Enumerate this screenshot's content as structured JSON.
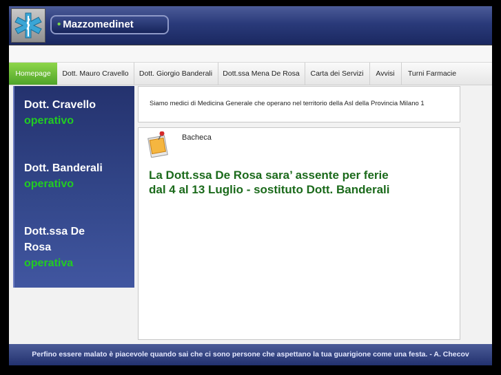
{
  "header": {
    "brand": "Mazzomedinet",
    "brand_dot": "•"
  },
  "nav": {
    "items": [
      {
        "label": "Homepage"
      },
      {
        "label": "Dott. Mauro Cravello"
      },
      {
        "label": "Dott. Giorgio Banderali"
      },
      {
        "label": "Dott.ssa Mena De Rosa"
      },
      {
        "label": "Carta dei Servizi"
      },
      {
        "label": "Avvisi"
      },
      {
        "label": "Turni Farmacie"
      }
    ],
    "active": "Homepage"
  },
  "sidebar": {
    "doctors": [
      {
        "name": "Dott. Cravello",
        "status": "operativo"
      },
      {
        "name": "Dott. Banderali",
        "status": "operativo"
      },
      {
        "name_line1": "Dott.ssa De",
        "name_line2": "Rosa",
        "status": "operativa"
      }
    ]
  },
  "intro": {
    "text": "Siamo medici di Medicina Generale che operano nel territorio della Asl della Provincia Milano 1"
  },
  "board": {
    "title": "Bacheca",
    "notice_line1": "La Dott.ssa De Rosa sara’ assente per ferie",
    "notice_line2": "dal 4 al 13 Luglio - sostituto Dott. Banderali"
  },
  "footer": {
    "quote": "Perfino essere malato è piacevole quando sai che ci sono persone che aspettano la tua guarigione come una festa. - A. Checov"
  },
  "colors": {
    "header_blue": "#2a3a7a",
    "nav_active_green": "#4fa42a",
    "status_green": "#22cc22",
    "notice_green": "#1b6a1b"
  }
}
